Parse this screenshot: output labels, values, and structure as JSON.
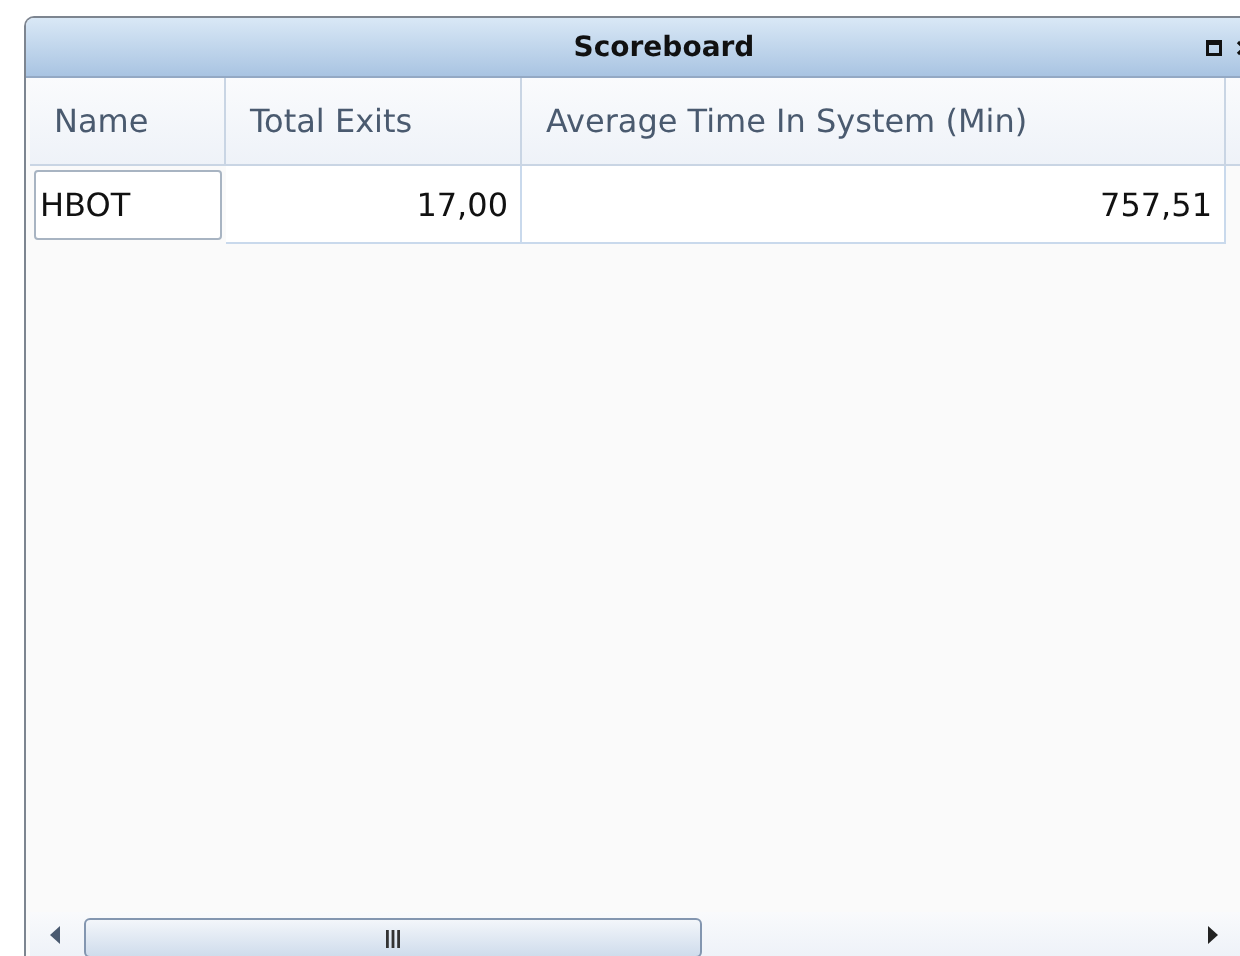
{
  "window": {
    "title": "Scoreboard"
  },
  "table": {
    "columns": [
      "Name",
      "Total Exits",
      "Average Time In System (Min)"
    ],
    "rows": [
      {
        "cells": [
          {
            "text": "HBOT",
            "selected": true
          },
          {
            "text": "17,00",
            "selected": false
          },
          {
            "text": "757,51",
            "selected": false
          }
        ]
      }
    ]
  }
}
